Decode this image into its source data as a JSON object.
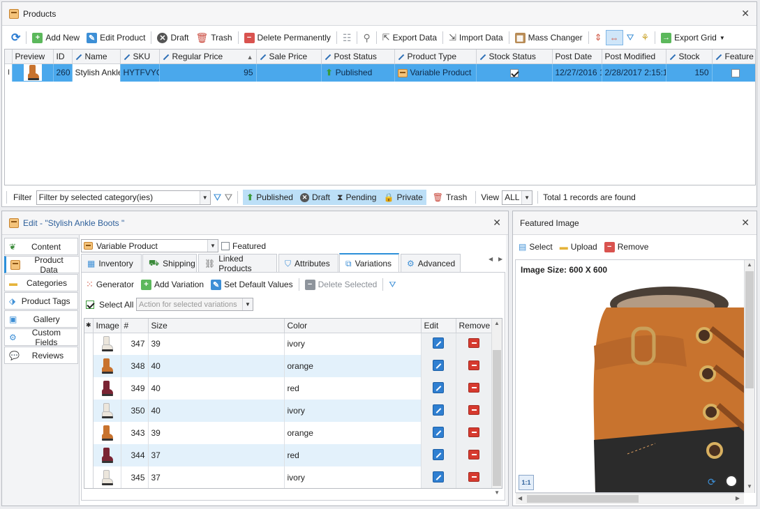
{
  "products_panel": {
    "title": "Products",
    "toolbar": {
      "add_new": "Add New",
      "edit_product": "Edit Product",
      "draft": "Draft",
      "trash": "Trash",
      "delete_permanently": "Delete Permanently",
      "export_data": "Export Data",
      "import_data": "Import Data",
      "mass_changer": "Mass Changer",
      "export_grid": "Export Grid"
    },
    "columns": [
      "Preview",
      "ID",
      "Name",
      "SKU",
      "Regular Price",
      "Sale Price",
      "Post Status",
      "Product Type",
      "Stock Status",
      "Post Date",
      "Post Modified",
      "Stock",
      "Feature"
    ],
    "row": {
      "id": "260",
      "name": "Stylish Ankle I",
      "sku": "HYTFVYGB",
      "regular_price": "95",
      "sale_price": "",
      "post_status": "Published",
      "product_type": "Variable Product",
      "stock_status_checked": true,
      "post_date": "12/27/2016 1",
      "post_modified": "2/28/2017 2:15:1",
      "stock": "150",
      "featured_checked": false
    },
    "row_marker": "I"
  },
  "filter_bar": {
    "filter_label": "Filter",
    "filter_value": "Filter by selected category(ies)",
    "published": "Published",
    "draft": "Draft",
    "pending": "Pending",
    "private": "Private",
    "trash": "Trash",
    "view_label": "View",
    "view_value": "ALL",
    "total": "Total 1 records are found"
  },
  "edit_panel": {
    "title": "Edit - \"Stylish Ankle Boots \"",
    "side_tabs": [
      "Content",
      "Product Data",
      "Categories",
      "Product Tags",
      "Gallery",
      "Custom Fields",
      "Reviews"
    ],
    "product_type": "Variable Product",
    "featured_label": "Featured",
    "tabs": [
      "Inventory",
      "Shipping",
      "Linked Products",
      "Attributes",
      "Variations",
      "Advanced"
    ],
    "var_toolbar": {
      "generator": "Generator",
      "add_variation": "Add Variation",
      "set_default": "Set Default Values",
      "delete_selected": "Delete Selected"
    },
    "select_all": "Select All",
    "action_placeholder": "Action for selected variations",
    "var_columns": [
      "Image",
      "#",
      "Size",
      "Color",
      "Edit",
      "Remove"
    ],
    "variations": [
      {
        "id": "347",
        "size": "39",
        "color": "ivory"
      },
      {
        "id": "348",
        "size": "40",
        "color": "orange"
      },
      {
        "id": "349",
        "size": "40",
        "color": "red"
      },
      {
        "id": "350",
        "size": "40",
        "color": "ivory"
      },
      {
        "id": "343",
        "size": "39",
        "color": "orange"
      },
      {
        "id": "344",
        "size": "37",
        "color": "red"
      },
      {
        "id": "345",
        "size": "37",
        "color": "ivory"
      }
    ]
  },
  "image_panel": {
    "title": "Featured Image",
    "select": "Select",
    "upload": "Upload",
    "remove": "Remove",
    "size_text": "Image Size: 600 X 600",
    "zoom_label": "1:1"
  },
  "colors": {
    "selection": "#4aa8ec",
    "alt_row": "#e3f1fb",
    "boot_tan": "#c8732e",
    "boot_red": "#7a2433",
    "boot_ivory": "#ece6dc"
  }
}
